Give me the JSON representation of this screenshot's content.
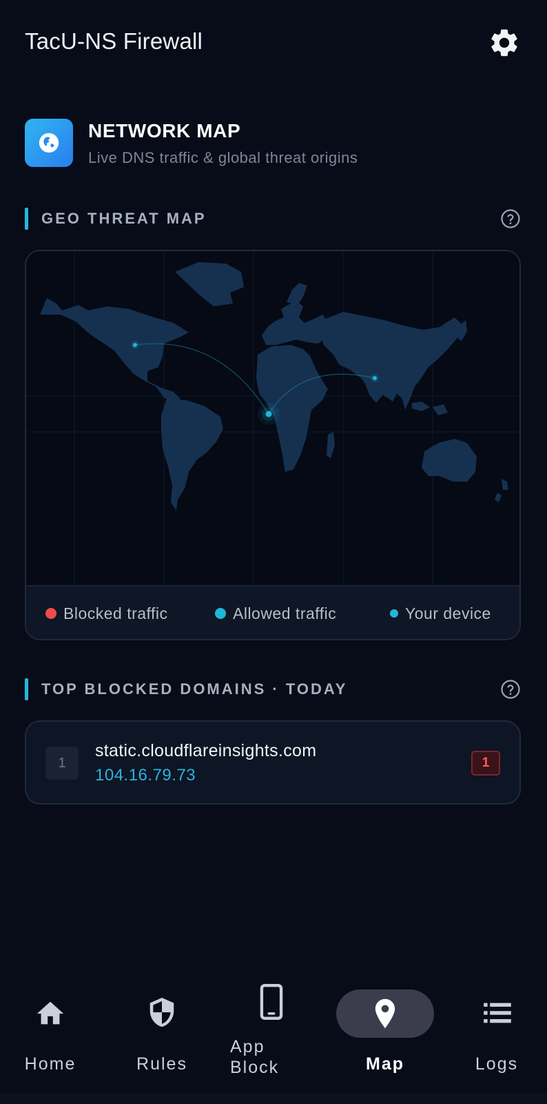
{
  "app": {
    "title": "TacU-NS Firewall"
  },
  "header": {
    "title": "NETWORK MAP",
    "subtitle": "Live DNS traffic & global threat origins"
  },
  "geo_section": {
    "label": "GEO THREAT MAP"
  },
  "legend": [
    {
      "label": "Blocked traffic",
      "color": "#ef4b4b"
    },
    {
      "label": "Allowed traffic",
      "color": "#20b7d8"
    },
    {
      "label": "Your device",
      "color": "#20b7d8"
    }
  ],
  "domains_section": {
    "label": "TOP BLOCKED DOMAINS · TODAY"
  },
  "domains": [
    {
      "rank": "1",
      "name": "static.cloudflareinsights.com",
      "ip": "104.16.79.73",
      "count": "1"
    }
  ],
  "nav": [
    {
      "label": "Home",
      "icon": "home-icon"
    },
    {
      "label": "Rules",
      "icon": "shield-icon"
    },
    {
      "label": "App Block",
      "icon": "phone-icon"
    },
    {
      "label": "Map",
      "icon": "map-pin-icon",
      "active": true
    },
    {
      "label": "Logs",
      "icon": "list-icon"
    }
  ],
  "colors": {
    "background": "#070c18",
    "accent": "#22b8d8",
    "blocked": "#ef4b4b",
    "land": "#163150"
  }
}
